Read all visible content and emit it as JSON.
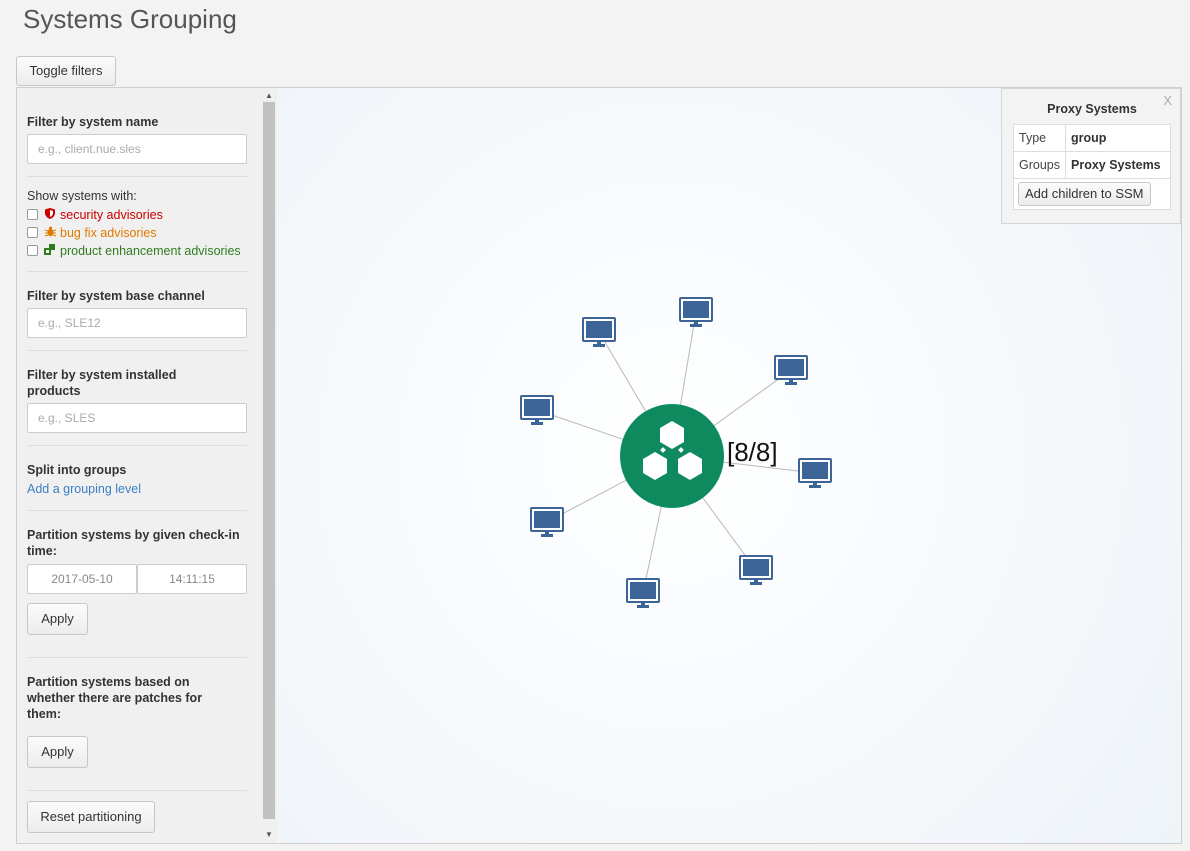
{
  "page": {
    "title": "Systems Grouping"
  },
  "toolbar": {
    "toggle_filters_label": "Toggle filters"
  },
  "filters": {
    "system_name": {
      "label": "Filter by system name",
      "placeholder": "e.g., client.nue.sles"
    },
    "advisories": {
      "label": "Show systems with:",
      "items": [
        {
          "label": "security advisories",
          "icon": "shield-icon",
          "color": "#cc0000"
        },
        {
          "label": "bug fix advisories",
          "icon": "bug-icon",
          "color": "#e07a00"
        },
        {
          "label": "product enhancement advisories",
          "icon": "enhancement-icon",
          "color": "#2f7d1c"
        }
      ]
    },
    "base_channel": {
      "label": "Filter by system base channel",
      "placeholder": "e.g., SLE12"
    },
    "installed_products": {
      "label": "Filter by system installed products",
      "placeholder": "e.g., SLES"
    },
    "split_groups": {
      "label": "Split into groups",
      "link": "Add a grouping level"
    },
    "checkin": {
      "label": "Partition systems by given check-in time:",
      "date": "2017-05-10",
      "time": "14:11:15",
      "apply_label": "Apply"
    },
    "patches": {
      "label": "Partition systems based on whether there are patches for them:",
      "apply_label": "Apply"
    },
    "reset_label": "Reset partitioning"
  },
  "graph": {
    "center_label": "[8/8]",
    "center_color": "#0f8a5f",
    "system_icon_color": "#3d6496",
    "system_count": 8
  },
  "info_panel": {
    "close_label": "X",
    "title": "Proxy Systems",
    "rows": [
      {
        "key": "Type",
        "value": "group"
      },
      {
        "key": "Groups",
        "value": "Proxy Systems"
      }
    ],
    "action_label": "Add children to SSM"
  }
}
